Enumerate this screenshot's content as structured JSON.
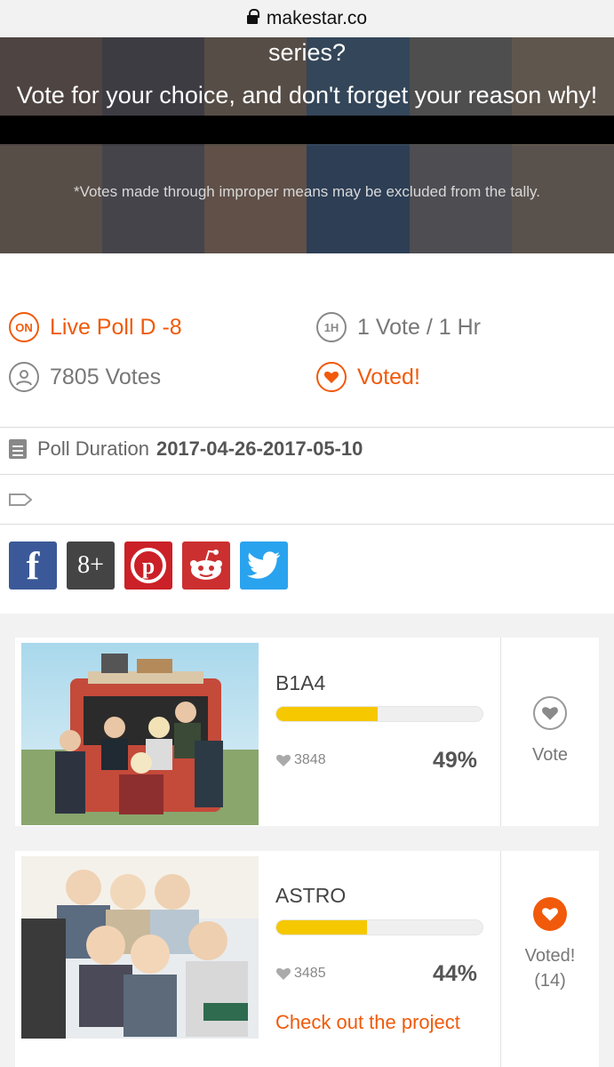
{
  "browser": {
    "url": "makestar.co"
  },
  "banner": {
    "line1": "series?",
    "line2": "Vote for your choice, and don't forget your reason why!",
    "note": "*Votes made through improper means may be excluded from the tally."
  },
  "poll_info": {
    "status_badge": "ON",
    "status": "Live Poll D -8",
    "limit_badge": "1H",
    "limit": "1 Vote / 1 Hr",
    "votes": "7805 Votes",
    "voted": "Voted!"
  },
  "duration": {
    "label": "Poll Duration",
    "value": "2017-04-26-2017-05-10"
  },
  "social": {
    "items": [
      {
        "name": "facebook",
        "glyph": "f",
        "color": "#3b5998"
      },
      {
        "name": "google-plus",
        "glyph": "8+",
        "color": "#444444"
      },
      {
        "name": "pinterest",
        "glyph": "P",
        "color": "#cb2027"
      },
      {
        "name": "reddit",
        "glyph": "reddit",
        "color": "#cc2f2f"
      },
      {
        "name": "twitter",
        "glyph": "t",
        "color": "#2aa3ef"
      }
    ]
  },
  "candidates": [
    {
      "name": "B1A4",
      "votes": "3848",
      "percent": "49%",
      "percent_value": 49,
      "vote_label": "Vote",
      "voted": false
    },
    {
      "name": "ASTRO",
      "votes": "3485",
      "percent": "44%",
      "percent_value": 44,
      "vote_label": "Voted!",
      "vote_count": "(14)",
      "voted": true,
      "link": "Check out the project"
    }
  ],
  "colors": {
    "accent": "#f05a0a",
    "bar": "#f5c800"
  }
}
